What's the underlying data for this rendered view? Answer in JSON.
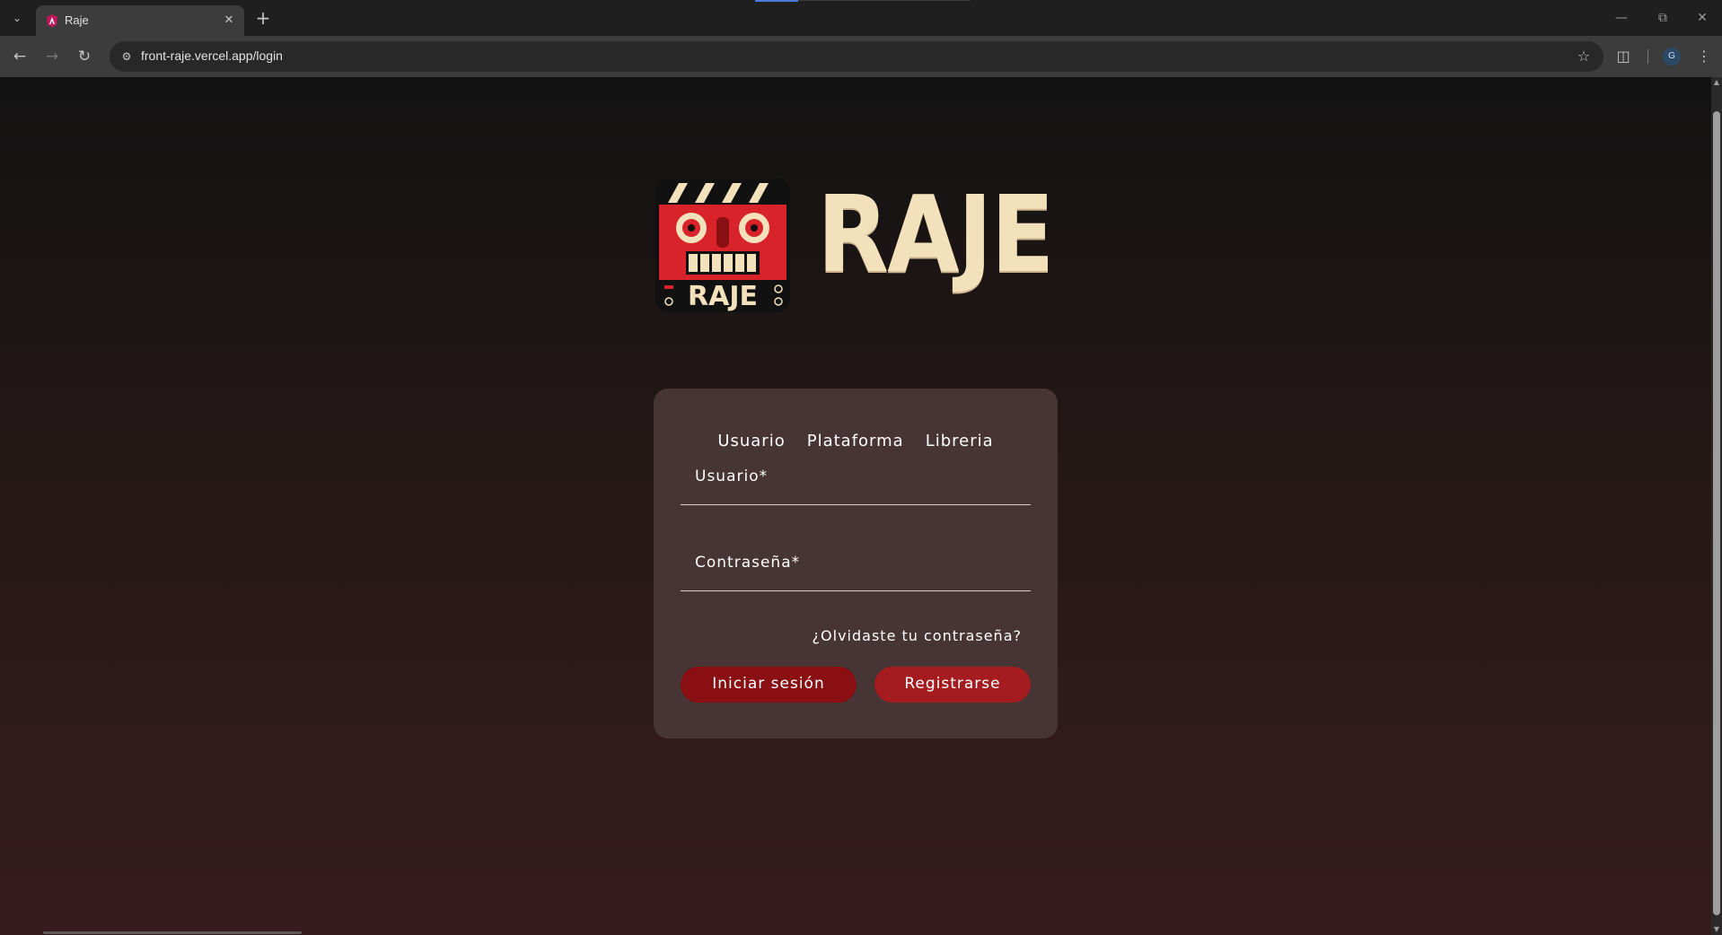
{
  "browser": {
    "tab": {
      "title": "Raje"
    },
    "url": "front-raje.vercel.app/login",
    "profile_initial": "G"
  },
  "brand": {
    "wordmark": "RAJE",
    "logo_text": "RAJE"
  },
  "login": {
    "tabs": [
      "Usuario",
      "Plataforma",
      "Libreria"
    ],
    "username_label": "Usuario*",
    "password_label": "Contraseña*",
    "forgot_link": "¿Olvidaste tu contraseña?",
    "login_button": "Iniciar sesión",
    "register_button": "Registrarse"
  },
  "colors": {
    "card_bg": "#473434",
    "login_button": "#8a0f12",
    "register_button": "#a51c20",
    "wordmark": "#f3e1bc"
  }
}
